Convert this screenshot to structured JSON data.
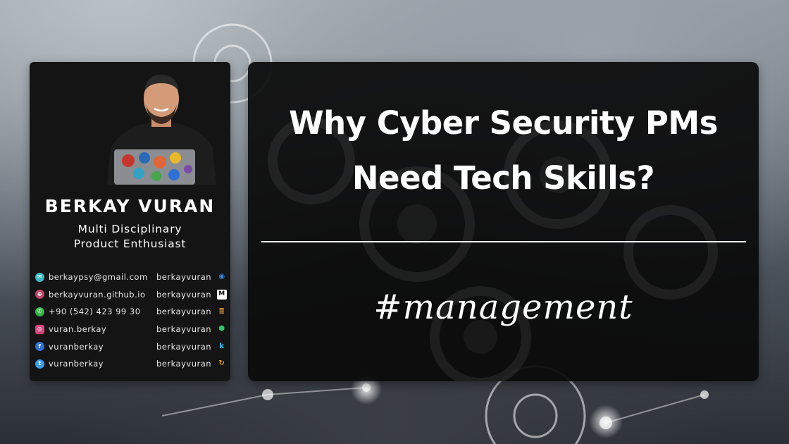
{
  "profile": {
    "name": "BERKAY VURAN",
    "tagline_line1": "Multi Disciplinary",
    "tagline_line2": "Product Enthusiast",
    "contacts": [
      {
        "icon": "email-icon",
        "text": "berkaypsy@gmail.com",
        "color": "#3fb8c8"
      },
      {
        "icon": "globe-icon",
        "text": "berkayvuran.github.io",
        "color": "#c0466a"
      },
      {
        "icon": "whatsapp-icon",
        "text": "+90 (542) 423 99 30",
        "color": "#3bb34a"
      },
      {
        "icon": "instagram-icon",
        "text": "vuran.berkay",
        "color": "#d7457c"
      },
      {
        "icon": "facebook-icon",
        "text": "vuranberkay",
        "color": "#2f6fd6"
      },
      {
        "icon": "twitter-icon",
        "text": "vuranberkay",
        "color": "#3a9df0"
      }
    ],
    "handles": [
      {
        "icon": "github-icon",
        "text": "berkayvuran",
        "color": "#3a8ee6"
      },
      {
        "icon": "medium-icon",
        "text": "berkayvuran",
        "color": "#ffffff"
      },
      {
        "icon": "stackoverflow-icon",
        "text": "berkayvuran",
        "color": "#f2a23a"
      },
      {
        "icon": "hackerrank-icon",
        "text": "berkayvuran",
        "color": "#2ec866"
      },
      {
        "icon": "kaggle-icon",
        "text": "berkayvuran",
        "color": "#20beff"
      },
      {
        "icon": "leetcode-icon",
        "text": "berkayvuran",
        "color": "#f0a81a"
      }
    ]
  },
  "title": {
    "line1": "Why Cyber Security PMs",
    "line2": "Need Tech Skills?",
    "hashtag": "#management"
  }
}
